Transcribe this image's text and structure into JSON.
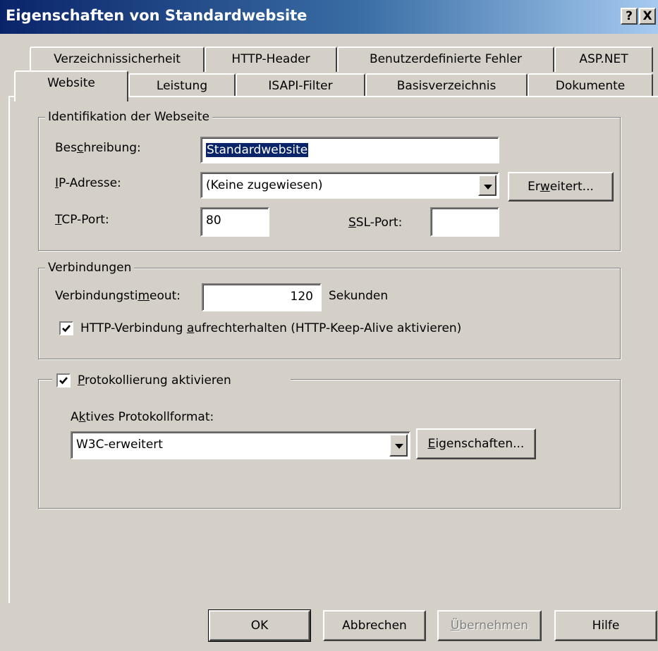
{
  "window": {
    "title": "Eigenschaften von Standardwebsite",
    "help_glyph": "?",
    "close_glyph": "X"
  },
  "tabs": {
    "row_back": [
      {
        "label": "Verzeichnissicherheit"
      },
      {
        "label": "HTTP-Header"
      },
      {
        "label": "Benutzerdefinierte Fehler"
      },
      {
        "label": "ASP.NET"
      }
    ],
    "row_front": [
      {
        "label": "Website",
        "active": true
      },
      {
        "label": "Leistung"
      },
      {
        "label": "ISAPI-Filter"
      },
      {
        "label": "Basisverzeichnis"
      },
      {
        "label": "Dokumente"
      }
    ]
  },
  "identification": {
    "legend": "Identifikation der Webseite",
    "description_label": {
      "pre": "Bes",
      "key": "c",
      "post": "hreibung:"
    },
    "description_value": "Standardwebsite",
    "ip_label": {
      "pre": "",
      "key": "I",
      "post": "P-Adresse:"
    },
    "ip_value": "(Keine zugewiesen)",
    "advanced_button": {
      "pre": "Er",
      "key": "w",
      "post": "eitert..."
    },
    "tcp_label": {
      "pre": "",
      "key": "T",
      "post": "CP-Port:"
    },
    "tcp_value": "80",
    "ssl_label": {
      "pre": "",
      "key": "S",
      "post": "SL-Port:"
    },
    "ssl_value": ""
  },
  "connections": {
    "legend": "Verbindungen",
    "timeout_label": {
      "pre": "Verbindungsti",
      "key": "m",
      "post": "eout:"
    },
    "timeout_value": "120",
    "timeout_unit": "Sekunden",
    "keepalive_checked": true,
    "keepalive_label": {
      "pre": "HTTP-Verbindung ",
      "key": "a",
      "post": "ufrechterhalten (HTTP-Keep-Alive aktivieren)"
    }
  },
  "logging": {
    "enabled_checked": true,
    "enabled_label": {
      "pre": "",
      "key": "P",
      "post": "rotokollierung aktivieren"
    },
    "format_label": {
      "pre": "A",
      "key": "k",
      "post": "tives Protokollformat:"
    },
    "format_value": "W3C-erweitert",
    "properties_button": {
      "pre": "",
      "key": "E",
      "post": "igenschaften..."
    }
  },
  "footer": {
    "ok": "OK",
    "cancel": "Abbrechen",
    "apply": {
      "pre": "",
      "key": "Ü",
      "post": "bernehmen"
    },
    "help": "Hilfe"
  }
}
